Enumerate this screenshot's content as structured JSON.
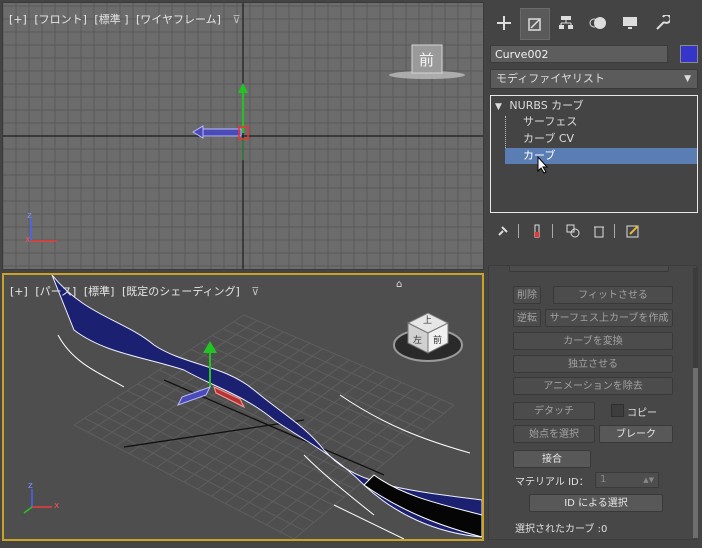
{
  "front_viewport": {
    "label_plus": "[+]",
    "label_view": "[フロント]",
    "label_shading": "[標準 ]",
    "label_mode": "[ワイヤフレーム]",
    "viewcube_face": "前"
  },
  "persp_viewport": {
    "label_plus": "[+]",
    "label_view": "[パース]",
    "label_shading": "[標準]",
    "label_mode": "[既定のシェーディング]",
    "viewcube_top": "上",
    "viewcube_front": "前",
    "viewcube_left": "左"
  },
  "axis": {
    "x": "x",
    "y": "y",
    "z": "z"
  },
  "panel": {
    "object_name": "Curve002",
    "object_color": "#3535c9",
    "modifier_list": "モディファイヤリスト",
    "stack": [
      {
        "label": "NURBS カーブ",
        "expanded": true
      },
      {
        "label": "サーフェス"
      },
      {
        "label": "カーブ CV"
      },
      {
        "label": "カーブ",
        "selected": true
      }
    ],
    "buttons": {
      "delete": "削除",
      "fit": "フィットさせる",
      "reverse": "逆転",
      "make_coc": "サーフェス上カーブを作成",
      "convert_curve": "カーブを変換",
      "make_independent": "独立させる",
      "remove_animation": "アニメーションを除去",
      "detach": "デタッチ",
      "copy": "コピー",
      "select_start": "始点を選択",
      "break": "ブレーク",
      "join": "接合",
      "material_id": "マテリアル ID：",
      "material_id_value": "1",
      "select_by_id": "ID による選択",
      "selected_curves": "選択されたカーブ :0"
    }
  },
  "colors": {
    "accent": "#5a7db3",
    "active_viewport_border": "#c9a227",
    "surface": "#1a1f7a"
  }
}
